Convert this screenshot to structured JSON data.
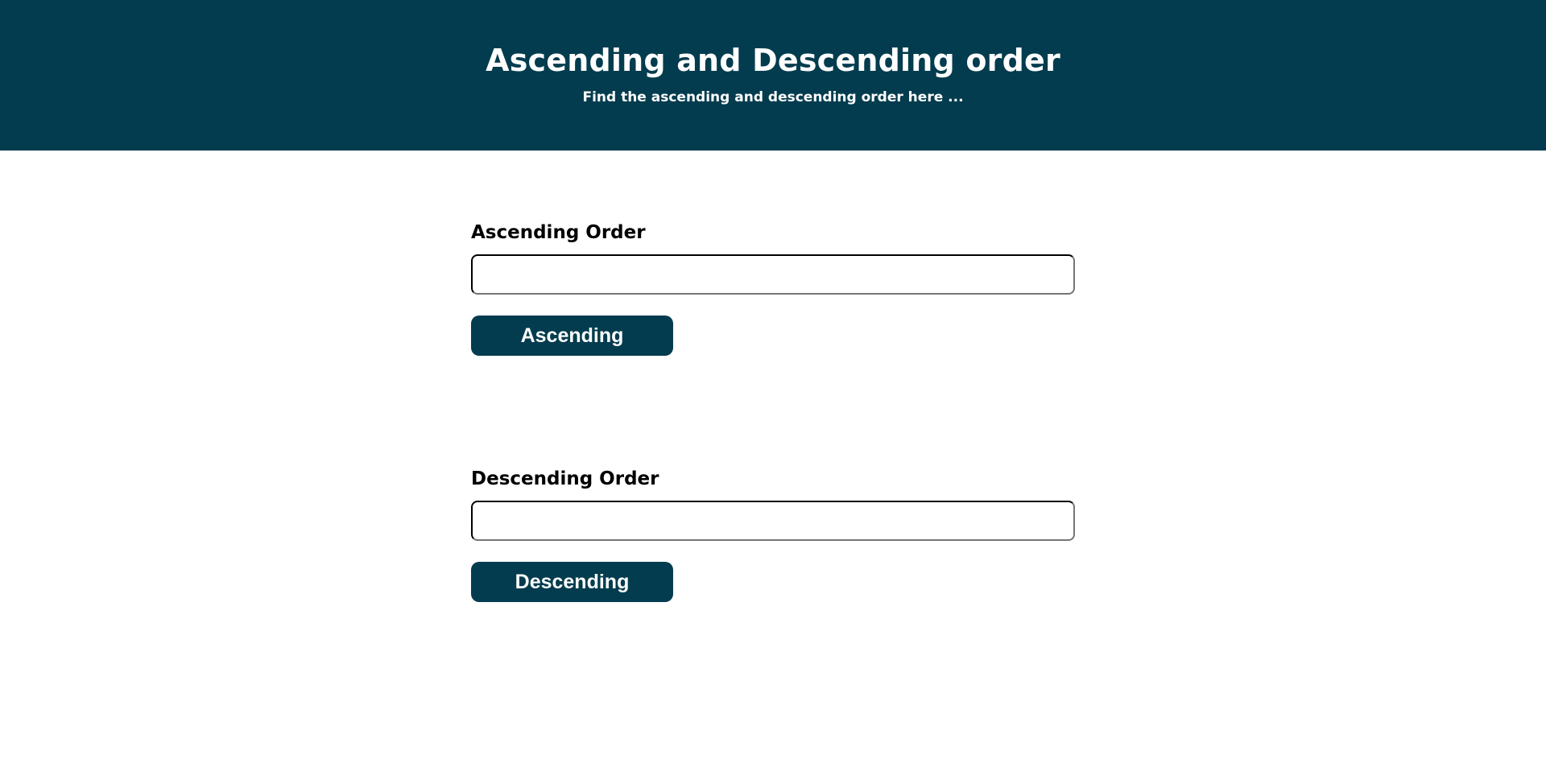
{
  "header": {
    "title": "Ascending and Descending order",
    "subtitle": "Find the ascending and descending order here ..."
  },
  "ascending": {
    "label": "Ascending Order",
    "input_value": "",
    "button_label": "Ascending"
  },
  "descending": {
    "label": "Descending Order",
    "input_value": "",
    "button_label": "Descending"
  },
  "colors": {
    "brand": "#033c4e",
    "background": "#ffffff",
    "text": "#000000"
  }
}
